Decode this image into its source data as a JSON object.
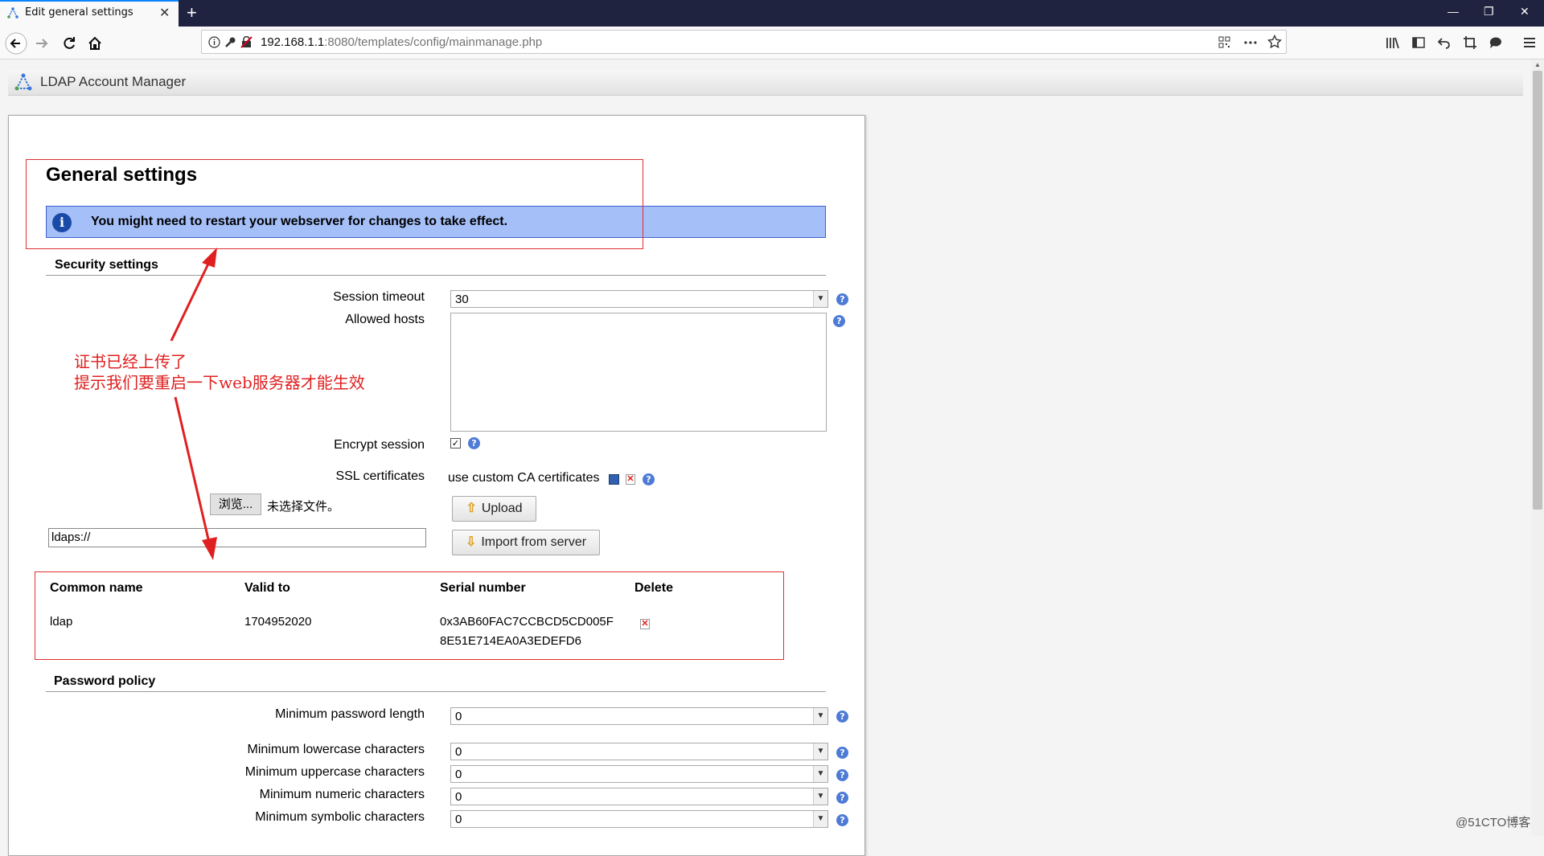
{
  "browser": {
    "tab_title": "Edit general settings",
    "tab_close": "✕",
    "new_tab": "+",
    "url_host": "192.168.1.1",
    "url_rest": ":8080/templates/config/mainmanage.php",
    "window_buttons": [
      "—",
      "❐",
      "✕"
    ]
  },
  "app": {
    "title": "LDAP Account Manager"
  },
  "page": {
    "title": "General settings",
    "info_message": "You might need to restart your webserver for changes to take effect."
  },
  "security": {
    "section_title": "Security settings",
    "session_timeout_label": "Session timeout",
    "session_timeout_value": "30",
    "allowed_hosts_label": "Allowed hosts",
    "allowed_hosts_value": "",
    "encrypt_session_label": "Encrypt session",
    "encrypt_session_checked": true,
    "ssl_label": "SSL certificates",
    "ssl_value": "use custom CA certificates",
    "upload_label": "Upload",
    "import_label": "Import from server",
    "browse_label": "浏览...",
    "no_file_label": "未选择文件。",
    "ldaps_url_value": "ldaps://"
  },
  "certificates": {
    "headers": [
      "Common name",
      "Valid to",
      "Serial number",
      "Delete"
    ],
    "rows": [
      {
        "common_name": "ldap",
        "valid_to": "1704952020",
        "serial_line1": "0x3AB60FAC7CCBCD5CD005F",
        "serial_line2": "8E51E714EA0A3EDEFD6"
      }
    ]
  },
  "password_policy": {
    "section_title": "Password policy",
    "fields": [
      {
        "label": "Minimum password length",
        "value": "0"
      },
      {
        "label": "Minimum lowercase characters",
        "value": "0"
      },
      {
        "label": "Minimum uppercase characters",
        "value": "0"
      },
      {
        "label": "Minimum numeric characters",
        "value": "0"
      },
      {
        "label": "Minimum symbolic characters",
        "value": "0"
      }
    ]
  },
  "annotation": {
    "line1": "证书已经上传了",
    "line2": "提示我们要重启一下web服务器才能生效",
    "color": "#e02020"
  },
  "watermark": "@51CTO博客",
  "icons": {
    "help": "?",
    "info": "i",
    "check": "✓",
    "delete": "✕",
    "arrow_down": "▼",
    "upload_arrow": "⇧",
    "import_arrow": "⇩"
  }
}
